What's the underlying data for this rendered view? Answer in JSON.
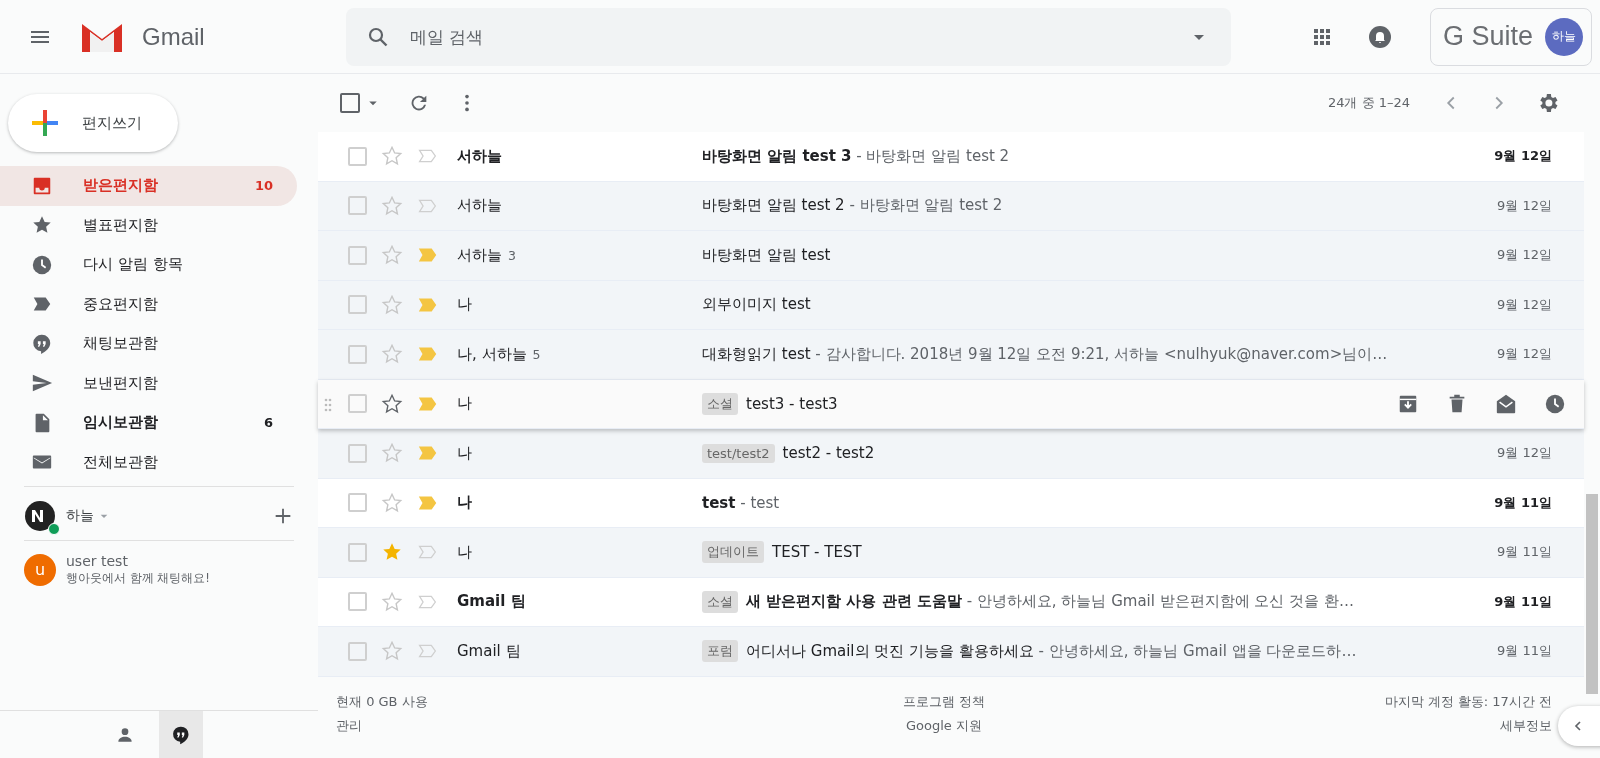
{
  "header": {
    "app_name": "Gmail",
    "search": {
      "placeholder": "메일 검색"
    },
    "suite_label": "G Suite",
    "avatar": "하늘"
  },
  "compose": {
    "label": "편지쓰기"
  },
  "sidebar": {
    "items": [
      {
        "label": "받은편지함",
        "count": "10",
        "kind": "inbox",
        "selected": true,
        "bold": true
      },
      {
        "label": "별표편지함",
        "kind": "star",
        "selected": false,
        "bold": false
      },
      {
        "label": "다시 알림 항목",
        "kind": "clock",
        "selected": false,
        "bold": false
      },
      {
        "label": "중요편지함",
        "kind": "important",
        "selected": false,
        "bold": false
      },
      {
        "label": "채팅보관함",
        "kind": "chat",
        "selected": false,
        "bold": false
      },
      {
        "label": "보낸편지함",
        "kind": "send",
        "selected": false,
        "bold": false
      },
      {
        "label": "임시보관함",
        "count": "6",
        "kind": "draft",
        "selected": false,
        "bold": true
      },
      {
        "label": "전체보관함",
        "kind": "mail",
        "selected": false,
        "bold": false
      }
    ]
  },
  "hangouts": {
    "user": "하늘",
    "online": true,
    "contacts": [
      {
        "initial": "u",
        "name": "user test",
        "message": "행아웃에서 함께 채팅해요!",
        "color": "#ef6c00"
      }
    ]
  },
  "toolbar": {
    "select_all": {
      "checked": false
    },
    "page_info": "24개 중 1–24"
  },
  "messages": [
    {
      "sender": "서하늘",
      "unread": true,
      "starred": false,
      "important": false,
      "hovered": false,
      "subject": "바탕화면 알림 test 3",
      "snippet": " - 바탕화면 알림 test 2",
      "date": "9월 12일"
    },
    {
      "sender": "서하늘",
      "unread": false,
      "starred": false,
      "important": false,
      "hovered": false,
      "subject": "바탕화면 알림 test 2",
      "snippet": " - 바탕화면 알림 test 2",
      "date": "9월 12일"
    },
    {
      "sender": "서하늘",
      "count": "3",
      "unread": false,
      "starred": false,
      "important": true,
      "hovered": false,
      "subject": "바탕화면 알림 test",
      "date": "9월 12일"
    },
    {
      "sender": "나",
      "unread": false,
      "starred": false,
      "important": true,
      "hovered": false,
      "subject": "외부이미지 test",
      "date": "9월 12일"
    },
    {
      "sender": "나, 서하늘",
      "count": "5",
      "unread": false,
      "starred": false,
      "important": true,
      "hovered": false,
      "subject": "대화형읽기 test",
      "snippet": " - 감사합니다. 2018년 9월 12일 오전 9:21, 서하늘 <nulhyuk@naver.com>님이…",
      "date": "9월 12일"
    },
    {
      "sender": "나",
      "unread": false,
      "starred": false,
      "important": true,
      "hovered": true,
      "label": "소셜",
      "subject": "test3 - test3"
    },
    {
      "sender": "나",
      "unread": false,
      "starred": false,
      "important": true,
      "hovered": false,
      "label": "test/test2",
      "subject": "test2 - test2",
      "date": "9월 12일"
    },
    {
      "sender": "나",
      "unread": true,
      "starred": false,
      "important": true,
      "hovered": false,
      "subject": "test",
      "snippet": " - test",
      "date": "9월 11일"
    },
    {
      "sender": "나",
      "unread": false,
      "starred": true,
      "important": false,
      "hovered": false,
      "label": "업데이트",
      "subject": "TEST - TEST",
      "date": "9월 11일"
    },
    {
      "sender": "Gmail 팀",
      "unread": true,
      "starred": false,
      "important": false,
      "hovered": false,
      "label": "소셜",
      "subject": "새 받은편지함 사용 관련 도움말",
      "snippet": " - 안녕하세요, 하늘님 Gmail 받은편지함에 오신 것을 환…",
      "date": "9월 11일"
    },
    {
      "sender": "Gmail 팀",
      "unread": false,
      "starred": false,
      "important": false,
      "hovered": false,
      "label": "포럼",
      "subject": "어디서나 Gmail의 멋진 기능을 활용하세요",
      "snippet": " - 안녕하세요, 하늘님 Gmail 앱을 다운로드하…",
      "date": "9월 11일"
    }
  ],
  "footer": {
    "storage": "현재 0 GB 사용",
    "manage": "관리",
    "policy": "프로그램 정책",
    "support": "Google 지원",
    "last_activity": "마지막 계정 활동: 17시간 전",
    "details": "세부정보"
  }
}
